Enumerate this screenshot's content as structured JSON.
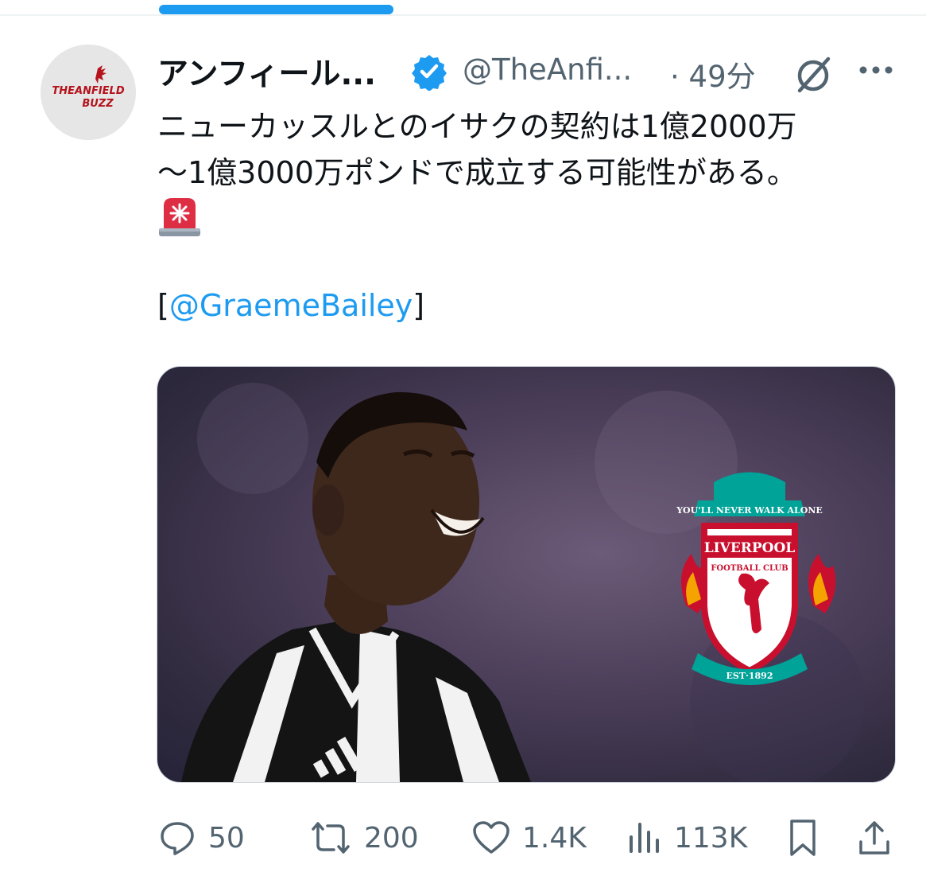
{
  "top_indicator": {
    "color": "#1d9bf0"
  },
  "author": {
    "avatar_text_line1": "THEANFIELD",
    "avatar_text_line2": "BUZZ",
    "display_name": "アンフィール...",
    "handle": "@TheAnfi...",
    "separator_time": "· 49分",
    "verified_color": "#1d9bf0"
  },
  "tweet": {
    "line1": "ニューカッスルとのイサクの契約は1億2000万",
    "line2": "〜1億3000万ポンドで成立する可能性がある。",
    "emoji": "rotating-light-emoji",
    "bracket_open": "[",
    "mention": "@GraemeBailey",
    "bracket_close": "]"
  },
  "media": {
    "crest_motto": "YOU'LL NEVER WALK ALONE",
    "crest_name": "LIVERPOOL",
    "crest_sub": "FOOTBALL CLUB",
    "crest_est": "EST·1892"
  },
  "actions": {
    "reply_count": "50",
    "retweet_count": "200",
    "like_count": "1.4K",
    "views_count": "113K"
  },
  "colors": {
    "text": "#0f1419",
    "muted": "#536471",
    "accent": "#1d9bf0",
    "crest_red": "#c8102e",
    "crest_green": "#00a398"
  }
}
